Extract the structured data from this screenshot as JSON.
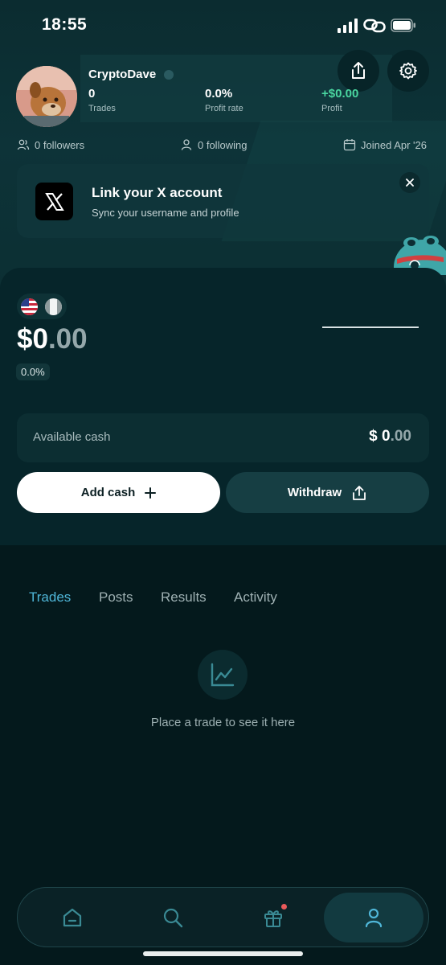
{
  "status_bar": {
    "time": "18:55"
  },
  "profile": {
    "username": "CryptoDave",
    "stats": [
      {
        "value": "0",
        "label": "Trades"
      },
      {
        "value": "0.0%",
        "label": "Profit rate"
      },
      {
        "value": "+$0.00",
        "label": "Profit"
      }
    ],
    "followers": "0 followers",
    "following": "0 following",
    "joined": "Joined Apr '26"
  },
  "link_card": {
    "title": "Link your X account",
    "subtitle": "Sync your username and profile"
  },
  "wallet": {
    "balance_main": "$0",
    "balance_cents": ".00",
    "change_pct": "0.0%",
    "available_label": "Available cash",
    "available_main": "$ 0",
    "available_cents": ".00",
    "add_cash_label": "Add cash",
    "withdraw_label": "Withdraw"
  },
  "tabs": [
    "Trades",
    "Posts",
    "Results",
    "Activity"
  ],
  "active_tab": "Trades",
  "empty_state": {
    "text": "Place a trade to see it here",
    "icon": "chart-icon"
  },
  "nav": {
    "items": [
      "home-icon",
      "search-icon",
      "gift-icon",
      "profile-icon"
    ],
    "active": "profile-icon"
  },
  "colors": {
    "accent": "#4fb6d8",
    "profit_green": "#4ad6a0",
    "background": "#051a1d"
  }
}
